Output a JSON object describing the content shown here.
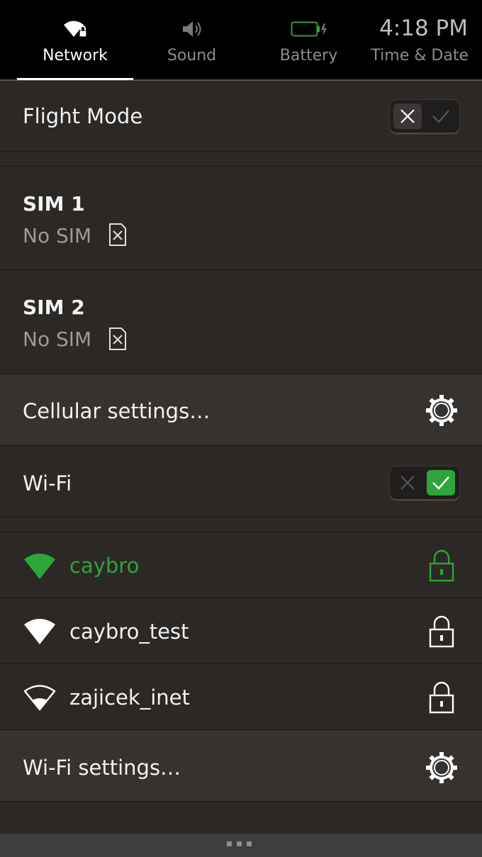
{
  "tabs": [
    {
      "label": "Network",
      "icon": "wifi-lock-icon",
      "active": true
    },
    {
      "label": "Sound",
      "icon": "speaker-icon",
      "active": false
    },
    {
      "label": "Battery",
      "icon": "battery-charging-icon",
      "active": false
    },
    {
      "label": "Time & Date",
      "time": "4:18 PM",
      "active": false
    }
  ],
  "flight_mode": {
    "label": "Flight Mode",
    "state": "off"
  },
  "sims": [
    {
      "title": "SIM 1",
      "status": "No SIM",
      "icon": "sim-missing-icon"
    },
    {
      "title": "SIM 2",
      "status": "No SIM",
      "icon": "sim-missing-icon"
    }
  ],
  "cellular_settings": {
    "label": "Cellular settings…",
    "icon": "gear-icon"
  },
  "wifi": {
    "label": "Wi-Fi",
    "state": "on"
  },
  "networks": [
    {
      "name": "caybro",
      "connected": true,
      "secured": true
    },
    {
      "name": "caybro_test",
      "connected": false,
      "secured": true
    },
    {
      "name": "zajicek_inet",
      "connected": false,
      "secured": true
    }
  ],
  "wifi_settings": {
    "label": "Wi-Fi settings…",
    "icon": "gear-icon"
  },
  "colors": {
    "accent": "#2ea43a",
    "background": "#2b2826",
    "highlight": "#353230"
  }
}
